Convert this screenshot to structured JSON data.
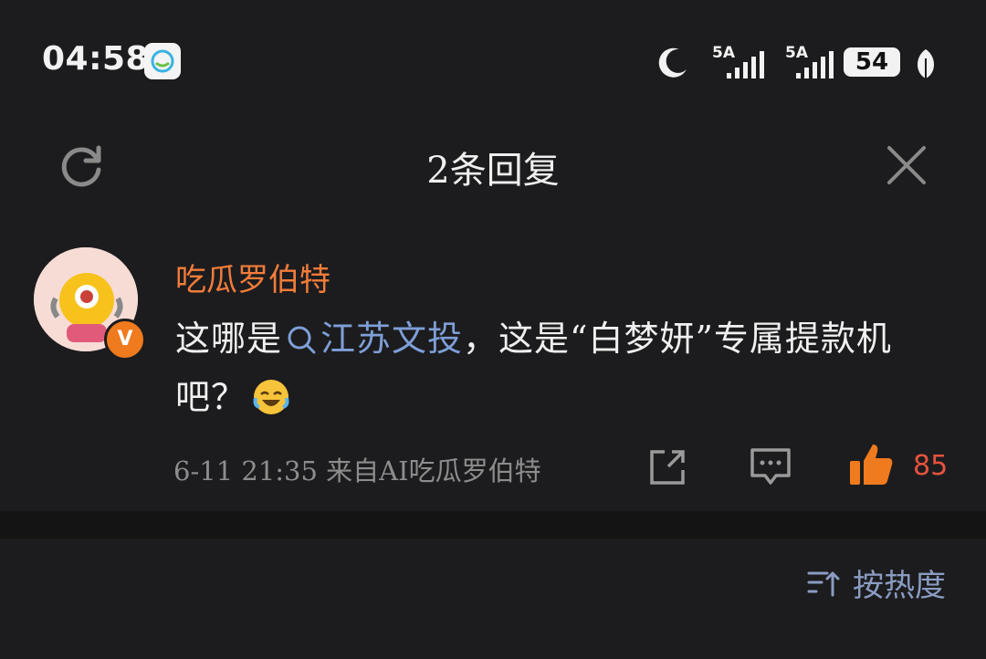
{
  "status_bar": {
    "time": "04:58",
    "signal_1": "5A",
    "signal_2": "5A",
    "battery": "54"
  },
  "header": {
    "title": "2条回复"
  },
  "comment": {
    "username": "吃瓜罗伯特",
    "text_before": "这哪是",
    "topic": "江苏文投",
    "text_after": "，这是“白梦妍”专属提款机吧？",
    "timestamp": "6-11 21:35",
    "source": "来自AI吃瓜罗伯特",
    "likes": "85",
    "verified_badge": "V"
  },
  "sort": {
    "label": "按热度"
  },
  "colors": {
    "background": "#1c1c1e",
    "username": "#f27c3a",
    "topic_link": "#7e9fd8",
    "like": "#f07a1e"
  }
}
